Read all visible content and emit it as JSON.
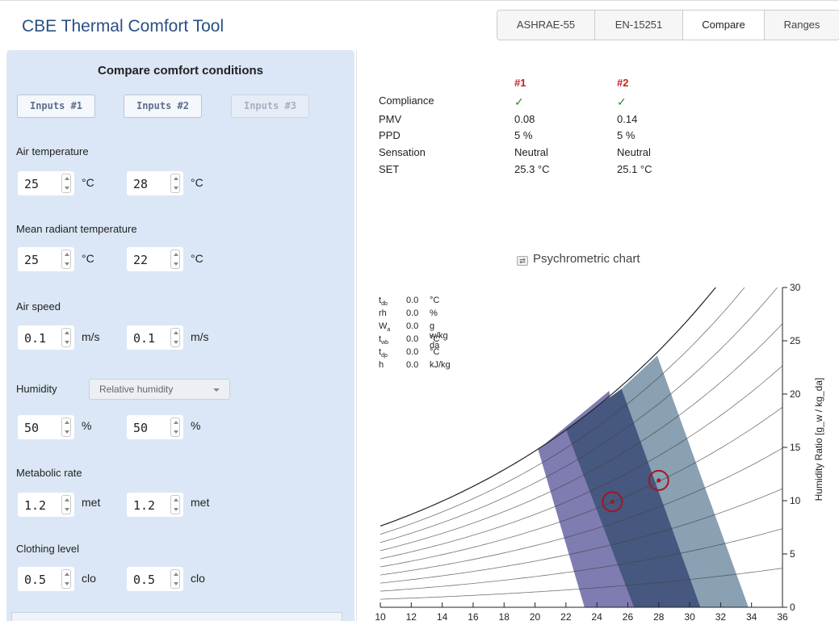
{
  "app_title": "CBE Thermal Comfort Tool",
  "tabs": [
    {
      "label": "ASHRAE-55",
      "active": false
    },
    {
      "label": "EN-15251",
      "active": false
    },
    {
      "label": "Compare",
      "active": true
    },
    {
      "label": "Ranges",
      "active": false
    }
  ],
  "panel": {
    "heading": "Compare comfort conditions",
    "input_buttons": [
      "Inputs #1",
      "Inputs #2",
      "Inputs #3"
    ],
    "fields": [
      {
        "label": "Air temperature",
        "v1": "25",
        "v2": "28",
        "unit": "°C"
      },
      {
        "label": "Mean radiant temperature",
        "v1": "25",
        "v2": "22",
        "unit": "°C"
      },
      {
        "label": "Air speed",
        "v1": "0.1",
        "v2": "0.1",
        "unit": "m/s"
      },
      {
        "label": "Humidity",
        "v1": "50",
        "v2": "50",
        "unit": "%"
      },
      {
        "label": "Metabolic rate",
        "v1": "1.2",
        "v2": "1.2",
        "unit": "met"
      },
      {
        "label": "Clothing level",
        "v1": "0.5",
        "v2": "0.5",
        "unit": "clo"
      }
    ],
    "humidity_select": "Relative humidity"
  },
  "results": {
    "headers": [
      "#1",
      "#2"
    ],
    "rows": [
      {
        "label": "Compliance",
        "v1": "✓",
        "v2": "✓"
      },
      {
        "label": "PMV",
        "v1": "0.08",
        "v2": "0.14"
      },
      {
        "label": "PPD",
        "v1": "5 %",
        "v2": "5 %"
      },
      {
        "label": "Sensation",
        "v1": "Neutral",
        "v2": "Neutral"
      },
      {
        "label": "SET",
        "v1": "25.3 °C",
        "v2": "25.1 °C"
      }
    ]
  },
  "chart_title": "Psychrometric chart",
  "readout": [
    {
      "key": "t",
      "sub": "db",
      "value": "0.0",
      "unit": "°C"
    },
    {
      "key": "rh",
      "sub": "",
      "value": "0.0",
      "unit": "%"
    },
    {
      "key": "W",
      "sub": "a",
      "value": "0.0",
      "unit": "g w/kg da"
    },
    {
      "key": "t",
      "sub": "wb",
      "value": "0.0",
      "unit": "°C"
    },
    {
      "key": "t",
      "sub": "dp",
      "value": "0.0",
      "unit": "°C"
    },
    {
      "key": "h",
      "sub": "",
      "value": "0.0",
      "unit": "kJ/kg"
    }
  ],
  "chart_data": {
    "type": "scatter",
    "xlabel": "",
    "ylabel": "Humidity Ratio [g_w / kg_da]",
    "xlim": [
      10,
      36
    ],
    "ylim": [
      0,
      30
    ],
    "xticks": [
      10,
      12,
      14,
      16,
      18,
      20,
      22,
      24,
      26,
      28,
      30,
      32,
      34,
      36
    ],
    "yticks": [
      0,
      5,
      10,
      15,
      20,
      25,
      30
    ],
    "comfort_zones": [
      {
        "color": "#7f7cb2",
        "polygon": [
          [
            20.2,
            14.8
          ],
          [
            24.8,
            20.3
          ],
          [
            26.4,
            0
          ],
          [
            23.2,
            0
          ]
        ]
      },
      {
        "color": "#8aa0b3",
        "polygon": [
          [
            25.6,
            20.5
          ],
          [
            27.9,
            23.6
          ],
          [
            33.8,
            0
          ],
          [
            30.7,
            0
          ]
        ]
      },
      {
        "color": "#46587f",
        "polygon": [
          [
            22.0,
            16.7
          ],
          [
            25.6,
            20.5
          ],
          [
            30.7,
            0
          ],
          [
            26.4,
            0
          ]
        ]
      }
    ],
    "points": [
      {
        "x": 25,
        "y": 9.9,
        "color": "#a4161a"
      },
      {
        "x": 28,
        "y": 11.9,
        "color": "#a4161a"
      }
    ],
    "colors": {
      "frame": "#222222",
      "rh_lines": "#444444"
    }
  }
}
